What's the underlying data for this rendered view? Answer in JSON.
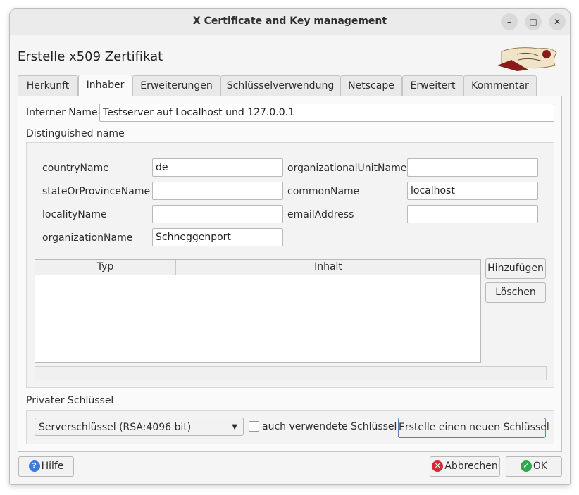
{
  "window": {
    "title": "X Certificate and Key management",
    "controls": {
      "minimize": "–",
      "maximize": "□",
      "close": "✕"
    }
  },
  "dialog": {
    "heading": "Erstelle x509 Zertifikat",
    "logo_icon": "xca-logo-scroll"
  },
  "tabs": [
    {
      "label": "Herkunft",
      "active": false
    },
    {
      "label": "Inhaber",
      "active": true
    },
    {
      "label": "Erweiterungen",
      "active": false
    },
    {
      "label": "Schlüsselverwendung",
      "active": false
    },
    {
      "label": "Netscape",
      "active": false
    },
    {
      "label": "Erweitert",
      "active": false
    },
    {
      "label": "Kommentar",
      "active": false
    }
  ],
  "subject": {
    "internal_name_label": "Interner Name",
    "internal_name_value": "Testserver auf Localhost und 127.0.0.1",
    "dn_label": "Distinguished name",
    "fields": {
      "countryName": {
        "label": "countryName",
        "value": "de"
      },
      "stateOrProvinceName": {
        "label": "stateOrProvinceName",
        "value": ""
      },
      "localityName": {
        "label": "localityName",
        "value": ""
      },
      "organizationName": {
        "label": "organizationName",
        "value": "Schneggenport"
      },
      "organizationalUnitName": {
        "label": "organizationalUnitName",
        "value": ""
      },
      "commonName": {
        "label": "commonName",
        "value": "localhost"
      },
      "emailAddress": {
        "label": "emailAddress",
        "value": ""
      }
    },
    "table": {
      "columns": [
        "Typ",
        "Inhalt"
      ],
      "rows": []
    },
    "add_button": "Hinzufügen",
    "delete_button": "Löschen"
  },
  "private_key": {
    "label": "Privater Schlüssel",
    "selected": "Serverschlüssel (RSA:4096 bit)",
    "checkbox_label": "auch verwendete Schlüssel",
    "checkbox_checked": false,
    "new_key_button": "Erstelle einen neuen Schlüssel"
  },
  "footer": {
    "help": {
      "label": "Hilfe",
      "icon": "help-icon"
    },
    "cancel": {
      "label": "Abbrechen",
      "icon": "cancel-icon"
    },
    "ok": {
      "label": "OK",
      "icon": "ok-icon"
    }
  },
  "colors": {
    "help_icon": "#3d7dd8",
    "cancel_icon": "#d6283a",
    "ok_icon": "#2fa84f",
    "logo_red": "#8b1a1a"
  }
}
